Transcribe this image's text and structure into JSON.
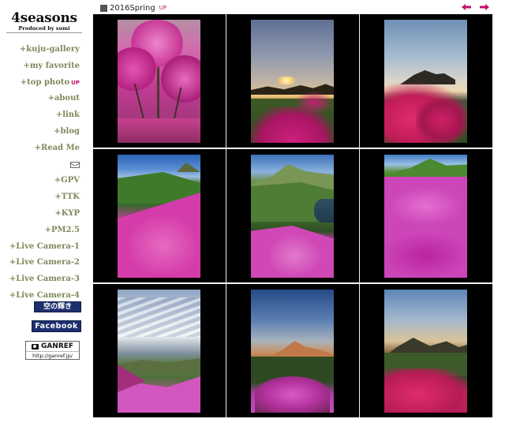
{
  "brand": {
    "title": "4seasons",
    "subtitle": "Produced by sumi"
  },
  "nav": {
    "items": [
      {
        "label": "+kuju-gallery"
      },
      {
        "label": "+my favorite"
      },
      {
        "label": "+top photo",
        "badge": "UP"
      },
      {
        "label": "+about"
      },
      {
        "label": "+link"
      },
      {
        "label": "+blog"
      },
      {
        "label": "+Read Me"
      },
      {
        "icon": "mail-icon"
      },
      {
        "label": "+GPV"
      },
      {
        "label": "+TTK"
      },
      {
        "label": "+KYP"
      },
      {
        "label": "+PM2.5"
      },
      {
        "label": "+Live Camera-1"
      },
      {
        "label": "+Live Camera-2"
      },
      {
        "label": "+Live Camera-3"
      },
      {
        "label": "+Live Camera-4"
      }
    ],
    "link_color": "#7c8a5a",
    "badge_color": "#c0106f"
  },
  "banners": {
    "sora": "空の輝き",
    "facebook": "Facebook",
    "ganref_title": "GANREF",
    "ganref_url": "http://ganref.jp/"
  },
  "header": {
    "season": "2016Spring",
    "badge": "UP",
    "prev_icon": "arrow-left-icon",
    "next_icon": "arrow-right-icon",
    "arrow_color": "#c0106f"
  },
  "gallery": {
    "rows": 3,
    "columns": 3,
    "photos": [
      {
        "subject": "azalea-tree"
      },
      {
        "subject": "sunrise-over-ridge"
      },
      {
        "subject": "azalea-field-dawn"
      },
      {
        "subject": "blue-sky-slope"
      },
      {
        "subject": "mountain-and-lake"
      },
      {
        "subject": "green-summit-meadow"
      },
      {
        "subject": "cloudy-sky-field"
      },
      {
        "subject": "glowing-peak"
      },
      {
        "subject": "hills-at-dusk"
      }
    ]
  }
}
